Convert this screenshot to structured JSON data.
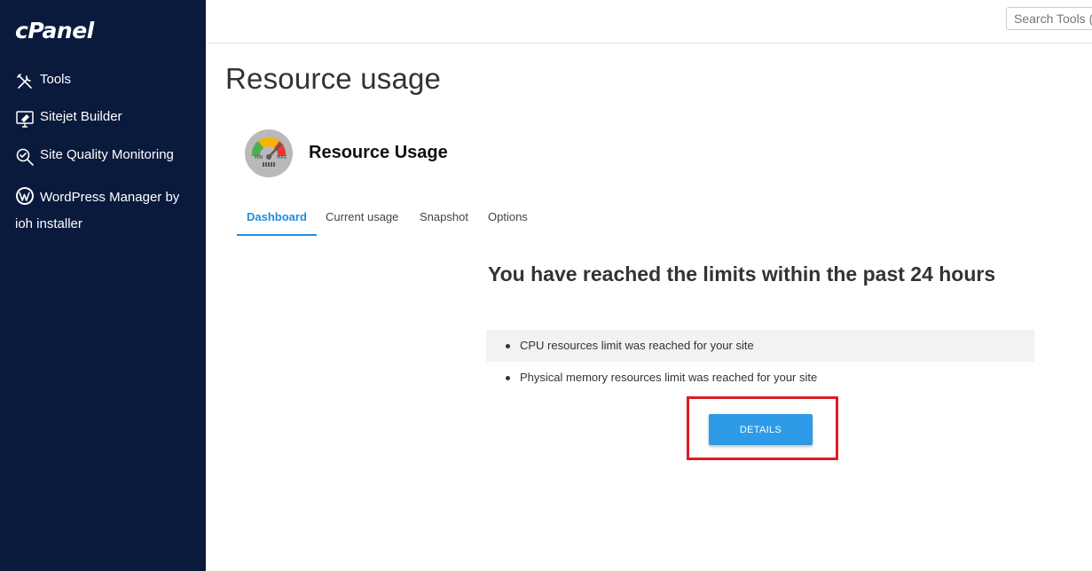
{
  "sidebar": {
    "logo": "cPanel",
    "items": [
      {
        "label": "Tools",
        "icon": "tools-icon"
      },
      {
        "label": "Sitejet Builder",
        "icon": "monitor-builder-icon"
      },
      {
        "label": "Site Quality Monitoring",
        "icon": "magnifier-check-icon"
      },
      {
        "label": "WordPress Manager by ioh installer",
        "icon": "wordpress-icon"
      }
    ]
  },
  "header": {
    "search_placeholder": "Search Tools (/)"
  },
  "page": {
    "title": "Resource usage",
    "app_title": "Resource Usage",
    "gauge_labels": {
      "min": "MIN",
      "max": "MAX"
    },
    "tabs": [
      {
        "label": "Dashboard",
        "active": true
      },
      {
        "label": "Current usage",
        "active": false
      },
      {
        "label": "Snapshot",
        "active": false
      },
      {
        "label": "Options",
        "active": false
      }
    ],
    "headline": "You have reached the limits within the past 24 hours",
    "limits": [
      "CPU resources limit was reached for your site",
      "Physical memory resources limit was reached for your site"
    ],
    "details_label": "DETAILS"
  },
  "colors": {
    "sidebar_bg": "#091a3d",
    "accent": "#1d8fdc",
    "button": "#2d9be8",
    "highlight": "#e01b24"
  }
}
